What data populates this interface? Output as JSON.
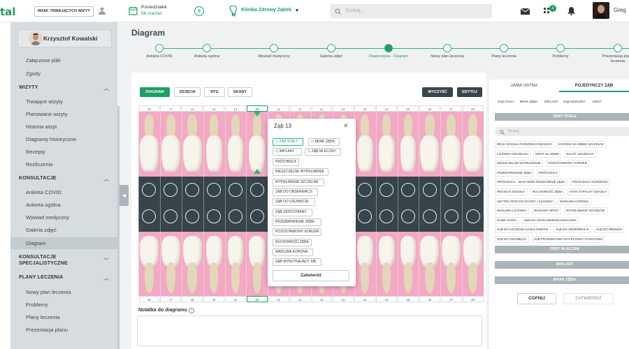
{
  "topbar": {
    "logo": "tal",
    "active_visits_button": "BRAK TRWAJĄCYCH WIZYT",
    "date_day": "Poniedziałek",
    "date": "08 marzec",
    "clinic": "Klinika Zdrowy Ząbek",
    "search_placeholder": "Szukaj...",
    "notifications_count": "3",
    "user_name": "Greg"
  },
  "sidebar": {
    "patient_name": "Krzysztof Kowalski",
    "items_top": [
      "Załączone pliki",
      "Zgody"
    ],
    "section_wizyty": "WIZYTY",
    "wizyty_items": [
      "Trwające wizyty",
      "Planowane wizyty",
      "Historia wizyt",
      "Diagramy historyczne",
      "Recepty",
      "Rozliczenia"
    ],
    "section_konsultacje": "KONSULTACJE",
    "konsultacje_items": [
      "Ankieta COVID",
      "Ankieta ogólna",
      "Wywiad medyczny",
      "Galeria zdjęć",
      "Diagram"
    ],
    "section_konsultacje_spec_1": "KONSULTACJE",
    "section_konsultacje_spec_2": "SPECJALISTYCZNE",
    "section_plany": "PLANY LECZENIA",
    "plany_items": [
      "Nowy plan leczenia",
      "Problemy",
      "Plany leczenia",
      "Prezentacja planu"
    ]
  },
  "page": {
    "title": "Diagram",
    "steps": [
      "Ankieta COVID",
      "Ankieta ogólna",
      "Wywiad medyczny",
      "Galeria zdjęć",
      "Diagnostyka - Diagram",
      "Nowy plan leczenia",
      "Plany leczenia",
      "Problemy",
      "Prezentacja planu leczenia"
    ],
    "current_step": 4
  },
  "toolbar": {
    "tabs": [
      "DIAGRAM",
      "ZDJĘCIA",
      "RTG",
      "SKANY"
    ],
    "clear": "WYCZYŚĆ",
    "edit": "EDYTUJ"
  },
  "chart": {
    "upper_numbers": [
      "18",
      "17",
      "16",
      "15",
      "14",
      "13",
      "12",
      "11",
      "21",
      "22",
      "23",
      "24",
      "25",
      "26",
      "27",
      "28"
    ],
    "lower_numbers": [
      "48",
      "47",
      "46",
      "45",
      "44",
      "43",
      "42",
      "41",
      "31",
      "32",
      "33",
      "34",
      "35",
      "36",
      "37",
      "38"
    ],
    "selected_index": 5
  },
  "popup": {
    "title": "Ząb 13",
    "chips": [
      "ZĄB STAŁY",
      "BRAK ZĘBA",
      "IMPLANT",
      "ZĄB MLECZNY",
      "PRÓCHNICA",
      "NIESZCZELNE WYPEŁNIENIE",
      "WYPEŁNIENIE SZCZELNE",
      "ZĄB DO OBSERWACJI",
      "ZĄB DO USUNIĘCIA",
      "ZĄB ZATRZYMANY",
      "PRZEBARWIENIE ZĘBA",
      "POZOSTAWIONY KORZEŃ",
      "RUCHOMOŚĆ ZĘBA",
      "WADLIWA KORONA",
      "ZĄB WYRZYNAJĄCY SIĘ"
    ],
    "confirm": "Zatwierdź"
  },
  "notes": {
    "label": "Notatka do diagramu"
  },
  "right_panel": {
    "tabs": [
      "JAMA USTNA",
      "POJEDYNCZY ZĄB"
    ],
    "type_tags": [
      "ZĄB STAŁY",
      "BRAK ZĘBA",
      "IMPLANT",
      "ZĄB MLECZNY",
      "MOST"
    ],
    "section_permanent": "ZĘBY STAŁE",
    "search_placeholder": "Szukaj",
    "condition_tags": [
      "BRAK DZIĄSŁA RODZWACICIĘCEGO",
      "KORONA NA ZĘBIE SZCZELNA",
      "LICÓWKA SZCZELNA",
      "MOST NA ZĘBIE",
      "NALOT SZCZELNY",
      "NIESZCZELNE WYPEŁNIENIE",
      "POZOSTAWIONY KORZEŃ",
      "PRZEBARWIENIE ZĘBA",
      "PRÓCHNICA",
      "PRÓCHNICA - MASYWNE ZNISZCZENIE ZĘBA",
      "PRÓCHNICA KORZENIA",
      "RECESJA DZIĄSŁA",
      "RUCHOMOŚĆ ZĘBA",
      "STAN ZAPALNY DZIĄSŁA",
      "UBYTEK PRZYSZYJKOWY / KLINOWY",
      "WADLIWA KORONA",
      "WADLIWA LICÓWKA",
      "WADLIWY MOST",
      "WYPEŁNIENIE SZCZELNE",
      "ZANIK KOŚCI",
      "ZMIANA OKOŁOWIERZCHOŁKOWA",
      "ZĄB DO LECZENIA KANAŁOWEGO",
      "ZĄB DO OBSERWACJI",
      "ZĄB DO REENDO",
      "ZĄB DO USUNIĘCIA",
      "ZĄB PRAWIDŁOWO WYLECZONY KANAŁOWO"
    ],
    "section_milk": "ZĘBY MLECZNE",
    "section_implant": "IMPLANT",
    "section_missing": "BRAK ZĘBA",
    "cancel": "COFNIJ",
    "confirm": "ZATWIERDŹ"
  },
  "colors": {
    "brand": "#1f9d63",
    "chart_pink": "#f2a9c4",
    "chart_dark": "#37454a"
  }
}
